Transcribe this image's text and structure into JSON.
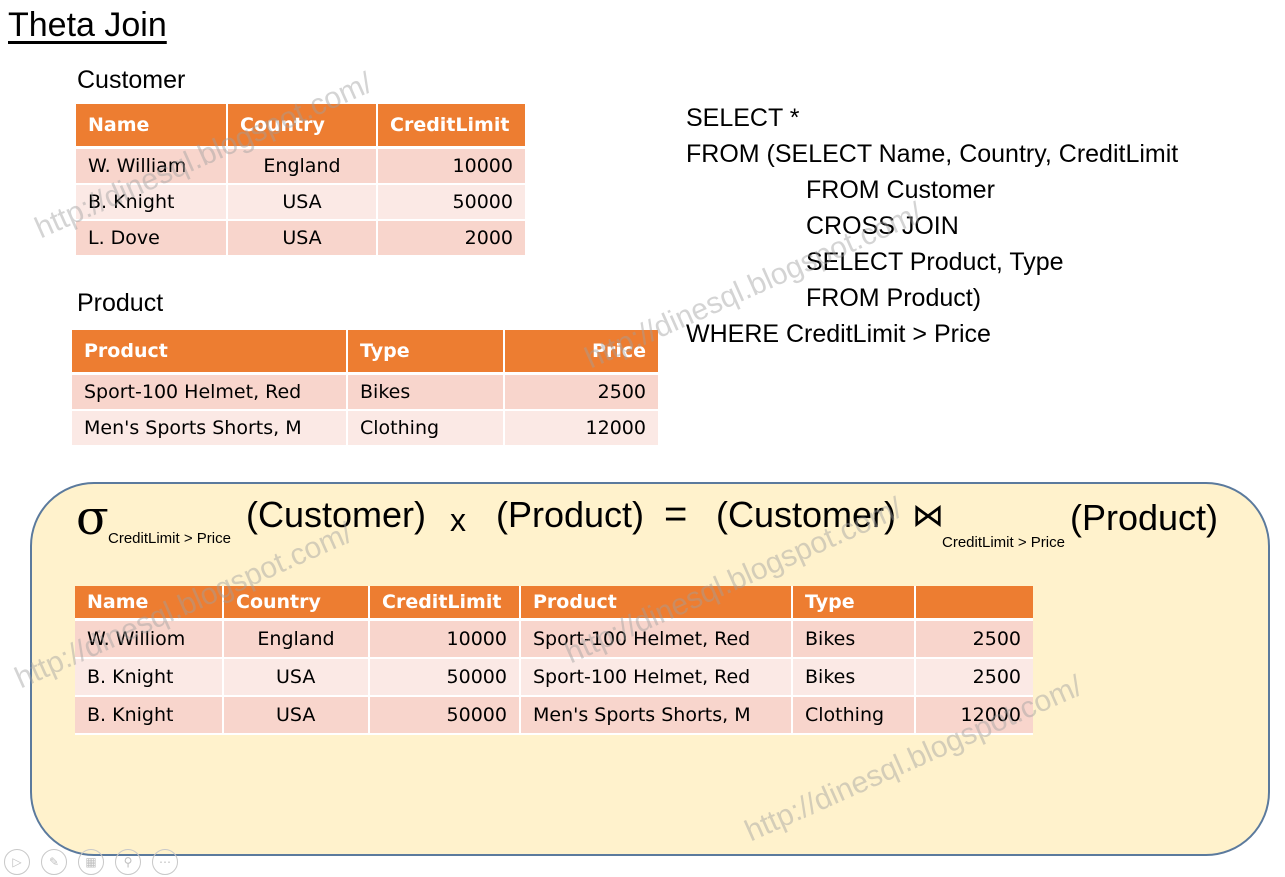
{
  "title": "Theta Join",
  "customer": {
    "caption": "Customer",
    "headers": [
      "Name",
      "Country",
      "CreditLimit"
    ],
    "rows": [
      [
        "W. William",
        "England",
        "10000"
      ],
      [
        "B. Knight",
        "USA",
        "50000"
      ],
      [
        "L. Dove",
        "USA",
        "2000"
      ]
    ]
  },
  "product": {
    "caption": "Product",
    "headers": [
      "Product",
      "Type",
      "Price"
    ],
    "rows": [
      [
        "Sport-100 Helmet, Red",
        "Bikes",
        "2500"
      ],
      [
        "Men's Sports Shorts, M",
        "Clothing",
        "12000"
      ]
    ]
  },
  "sql": {
    "line1": "SELECT *",
    "line2": "FROM (SELECT Name, Country, CreditLimit",
    "line3": "FROM Customer",
    "line4": "CROSS JOIN",
    "line5": "SELECT Product, Type",
    "line6": "FROM Product)",
    "line7": "WHERE CreditLimit > Price"
  },
  "expression": {
    "sigma": "σ",
    "sigma_sub": "CreditLimit > Price",
    "left_operand": "(Customer)",
    "cross": "x",
    "right_operand": "(Product)",
    "equals": "=",
    "join_left": "(Customer)",
    "join_symbol": "⋈",
    "join_sub": "CreditLimit > Price",
    "join_right": "(Product)"
  },
  "result": {
    "headers": [
      "Name",
      "Country",
      "CreditLimit",
      "Product",
      "Type",
      ""
    ],
    "rows": [
      [
        "W. Williom",
        "England",
        "10000",
        "Sport-100 Helmet, Red",
        "Bikes",
        "2500"
      ],
      [
        "B. Knight",
        "USA",
        "50000",
        "Sport-100 Helmet, Red",
        "Bikes",
        "2500"
      ],
      [
        "B. Knight",
        "USA",
        "50000",
        "Men's Sports Shorts, M",
        "Clothing",
        "12000"
      ]
    ]
  },
  "watermark_text": "http://dinesql.blogspot.com/",
  "controls": [
    "play-icon",
    "pen-icon",
    "slides-icon",
    "zoom-icon",
    "more-icon"
  ]
}
